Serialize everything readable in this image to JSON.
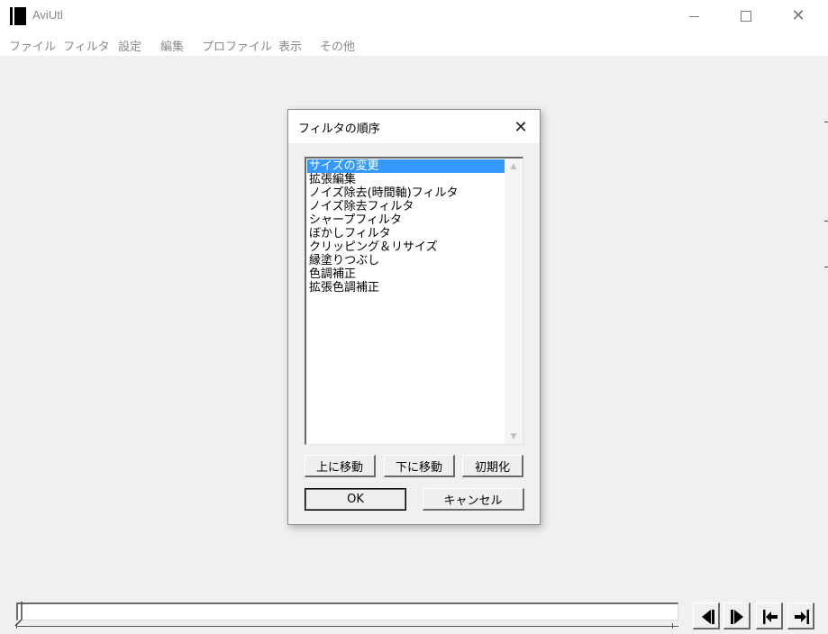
{
  "window": {
    "title": "AviUtl"
  },
  "menu": {
    "items": [
      "ファイル",
      "フィルタ",
      "設定",
      "編集",
      "プロファイル",
      "表示",
      "その他"
    ]
  },
  "dialog": {
    "title": "フィルタの順序",
    "filters": [
      "サイズの変更",
      "拡張編集",
      "ノイズ除去(時間軸)フィルタ",
      "ノイズ除去フィルタ",
      "シャープフィルタ",
      "ぼかしフィルタ",
      "クリッピング＆リサイズ",
      "縁塗りつぶし",
      "色調補正",
      "拡張色調補正"
    ],
    "selected_index": 0,
    "buttons": {
      "move_up": "上に移動",
      "move_down": "下に移動",
      "reset": "初期化",
      "ok": "OK",
      "cancel": "キャンセル"
    }
  },
  "colors": {
    "selection": "#3399ff",
    "background": "#f0f0f0"
  },
  "icons": {
    "nav": [
      "prev-frame-icon",
      "next-frame-icon",
      "jump-to-start-icon",
      "jump-to-end-icon"
    ]
  },
  "seek": {
    "position_fraction": 0
  }
}
